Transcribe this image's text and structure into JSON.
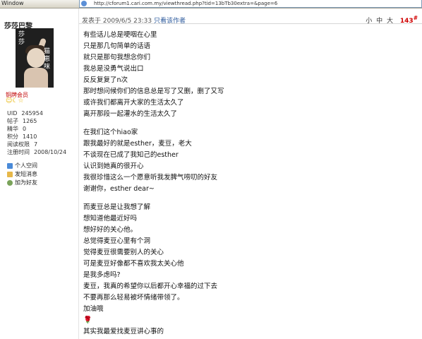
{
  "browser": {
    "window_label": "Window",
    "url": "http://cforum1.cari.com.my/viewthread.php?tid=13bTb30extra=&page=6"
  },
  "author": {
    "name": "莎莎巴黎",
    "avatar_text_left": "莎莎",
    "avatar_text_right": "猫崽咪",
    "rank": "铜牌会员",
    "stars": "☺☾☆",
    "stats": [
      {
        "label": "UID",
        "value": "245954"
      },
      {
        "label": "帖子",
        "value": "1265"
      },
      {
        "label": "精华",
        "value": "0"
      },
      {
        "label": "积分",
        "value": "1410"
      },
      {
        "label": "阅读权限",
        "value": "7"
      },
      {
        "label": "注册时间",
        "value": "2008/10/24"
      }
    ],
    "links": [
      "个人空间",
      "发短消息",
      "加为好友"
    ]
  },
  "post": {
    "posted_at": "发表于 2009/6/5 23:33",
    "only_author": "只看该作者",
    "font_sizes": [
      "小",
      "中",
      "大"
    ],
    "floor": "143",
    "floor_suffix": "#",
    "paragraphs": [
      [
        "有些话儿总是哽咽在心里",
        "只是那几句简单的话语",
        "就只是那句我想念你们",
        "我总是没勇气说出口",
        "反反复复了n次",
        "那时想问候你们的信息总是写了又删，删了又写",
        "或许我们都离开大家的生活太久了",
        "离开那段一起灌水的生活太久了"
      ],
      [
        "在我们这个hiao家",
        "跟我最好的就是esther，麦豆，老大",
        "不谈现在已成了我知己的esther",
        "认识到她真的很开心",
        "我很珍惜这么一个愿意听我发脾气唠叨的好友",
        "谢谢你，esther dear~"
      ],
      [
        "而麦豆总是让我想了解",
        "想知道他最近好吗",
        "想好好的关心他。",
        "总觉得麦豆心里有个洞",
        "觉得麦豆很需要别人的关心",
        "可是麦豆好像都不喜欢我太关心他",
        "是我多虑吗?",
        "麦豆，我真的希望你以后都开心幸福的过下去",
        "不要再那么轻易被坏情绪带领了。",
        "加油哦",
        "🌹",
        "其实我最爱找麦豆讲心事的"
      ]
    ]
  },
  "colors": {
    "floor": "#d00000",
    "rank": "#c00000",
    "link": "#2c5a9c"
  }
}
